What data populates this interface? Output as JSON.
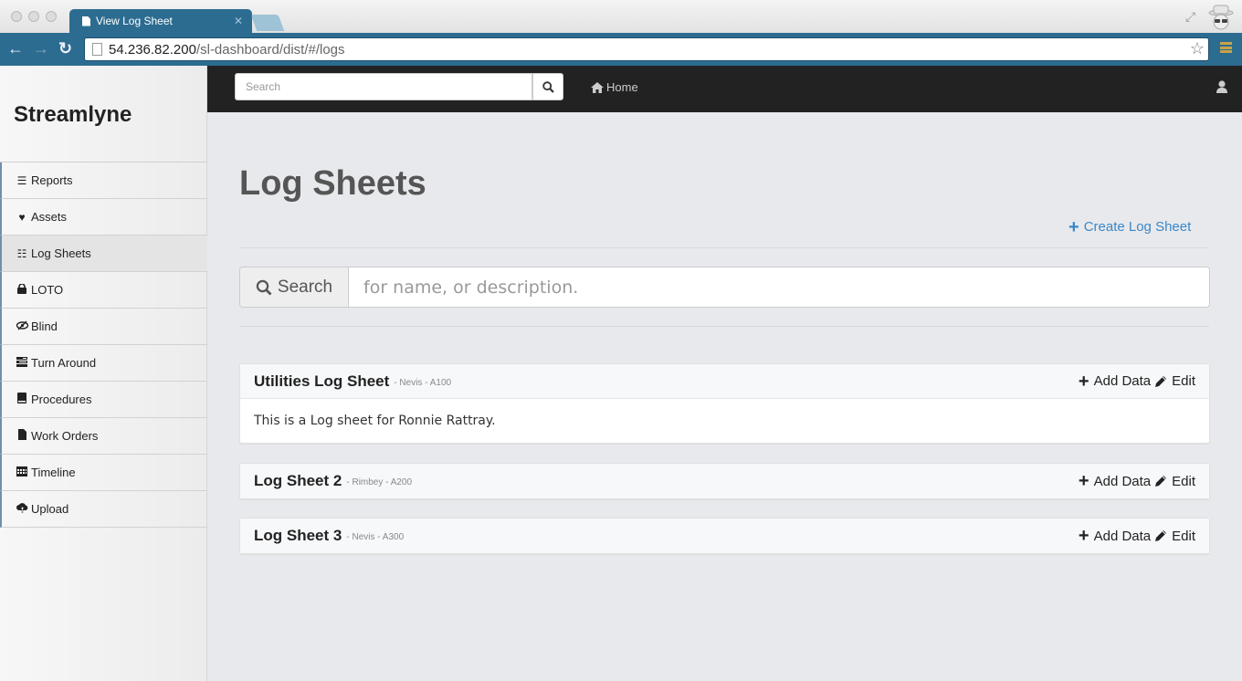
{
  "browser": {
    "tab_title": "View Log Sheet",
    "url_host": "54.236.82.200",
    "url_path": "/sl-dashboard/dist/#/logs"
  },
  "sidebar": {
    "brand": "Streamlyne",
    "items": [
      {
        "label": "Reports",
        "icon": "list-icon"
      },
      {
        "label": "Assets",
        "icon": "heart-icon"
      },
      {
        "label": "Log Sheets",
        "icon": "list-icon"
      },
      {
        "label": "LOTO",
        "icon": "lock-icon"
      },
      {
        "label": "Blind",
        "icon": "eye-slash-icon"
      },
      {
        "label": "Turn Around",
        "icon": "tasks-icon"
      },
      {
        "label": "Procedures",
        "icon": "book-icon"
      },
      {
        "label": "Work Orders",
        "icon": "file-icon"
      },
      {
        "label": "Timeline",
        "icon": "calendar-icon"
      },
      {
        "label": "Upload",
        "icon": "cloud-upload-icon"
      }
    ],
    "active_index": 2
  },
  "topbar": {
    "search_placeholder": "Search",
    "home_label": "Home"
  },
  "main": {
    "title": "Log Sheets",
    "create_label": "Create Log Sheet",
    "search_addon_label": "Search",
    "search_placeholder": "for name, or description.",
    "add_data_label": "Add Data",
    "edit_label": "Edit",
    "log_sheets": [
      {
        "name": "Utilities Log Sheet",
        "meta": "- Nevis - A100",
        "description": "This is a Log sheet for Ronnie Rattray."
      },
      {
        "name": "Log Sheet 2",
        "meta": "- Rimbey - A200",
        "description": ""
      },
      {
        "name": "Log Sheet 3",
        "meta": "- Nevis - A300",
        "description": ""
      }
    ]
  },
  "colors": {
    "browser_accent": "#2d6c91",
    "link": "#3a87c8",
    "topbar_bg": "#222222",
    "content_bg": "#e8e9ec"
  }
}
